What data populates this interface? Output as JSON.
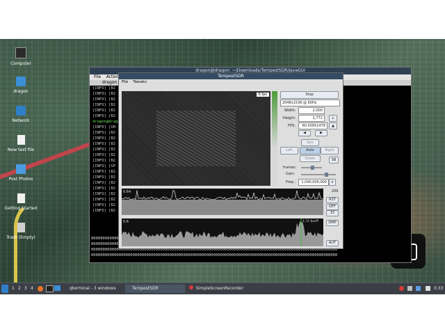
{
  "desktop": {
    "icons": [
      {
        "label": "Computer",
        "icon": "computer-icon"
      },
      {
        "label": "dragon",
        "icon": "home-folder-icon"
      },
      {
        "label": "Network",
        "icon": "network-icon"
      },
      {
        "label": "New text file",
        "icon": "text-file-icon"
      },
      {
        "label": "Post Photos",
        "icon": "folder-icon"
      },
      {
        "label": "Getting Started",
        "icon": "document-icon"
      },
      {
        "label": "Trash (Empty)",
        "icon": "trash-icon"
      }
    ]
  },
  "terminal": {
    "title": "dragon@dragon: ~/Downloads/TempestSDR/JavaGUI",
    "menu": [
      "File",
      "Actions"
    ],
    "tab": "dragon",
    "lines": [
      "[INFO] [B2",
      "[INFO] [B2",
      "[INFO] [B2",
      "[INFO] [B2",
      "[INFO] [B2",
      "[INFO] [B2",
      "dragon@dragon",
      "[INFO] [UH",
      "[INFO] [B2",
      "[INFO] [B2",
      "[INFO] [B2",
      "[INFO] [B2",
      "[INFO] [B2",
      "[INFO] [B2",
      "[INFO] [GP",
      "[INFO] [B2",
      "[INFO] [B2",
      "[INFO] [B2",
      "[INFO] [B2",
      "[INFO] [B2",
      "[INFO] [B2",
      "[INFO] [B2",
      "[INFO] [B2"
    ],
    "zeros_line": "00000000000000000000000000000000000000000000000000000000000000000000000000000000000000000000000000000000000"
  },
  "tempest": {
    "title": "TempestSDR",
    "menu": [
      "File",
      "Tweaks"
    ],
    "fps_overlay": "6 fps",
    "stop_label": "Stop",
    "resolution": "2048x1536 @ 60Hz",
    "width_label": "Width:",
    "width_value": "2,000",
    "height_label": "Height:",
    "height_value": "1,772",
    "fps_label": "FPS:",
    "fps_value": "60.00951478",
    "l_label": "L",
    "sync_label": "Syn",
    "left_label": "Left",
    "auto_label": "Auto",
    "right_label": "Right",
    "down_label": "Down",
    "sb_label": "SB",
    "frames_label": "frames:",
    "gain_label": "Gain:",
    "freq_label": "Freq.:",
    "freq_value": "1,090,000,000",
    "buttons": [
      "RST",
      "OFF",
      "15",
      "DMP",
      "AUT"
    ],
    "side_value": "206",
    "plot1_label": "0.64",
    "plot2_label": "0.6",
    "plot2_marker": "1.72 fps/ff"
  },
  "taskbar": {
    "workspaces": [
      "1",
      "2",
      "3",
      "4"
    ],
    "tasks": [
      "qterminal - 3 windows",
      "TempestSDR",
      "SimpleScreenRecorder"
    ],
    "clock": "0:33"
  },
  "colors": {
    "desktop": "#3e5848",
    "taskbar": "#3b3f45",
    "titlebar": "#344b63",
    "terminal_text": "#7cd66c"
  }
}
